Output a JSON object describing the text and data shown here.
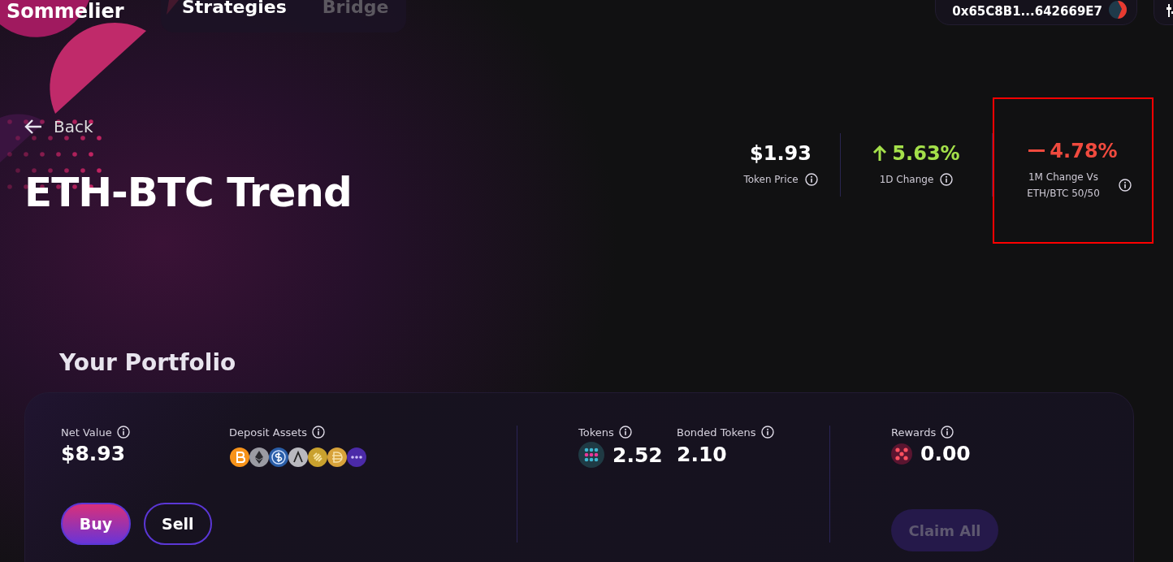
{
  "header": {
    "logo": "Sommelier",
    "nav": [
      {
        "label": "Strategies",
        "selected": true
      },
      {
        "label": "Bridge",
        "selected": false
      }
    ],
    "wallet": {
      "address": "0x65C8B1...642669E7"
    }
  },
  "back": {
    "label": "Back"
  },
  "title": "ETH-BTC Trend",
  "stats": [
    {
      "value": "$1.93",
      "label": "Token Price",
      "kind": "neutral",
      "highlighted": false
    },
    {
      "value": "5.63%",
      "label": "1D Change",
      "kind": "up",
      "highlighted": false
    },
    {
      "value": "4.78%",
      "label": "1M Change Vs ETH/BTC 50/50",
      "kind": "down",
      "highlighted": true
    }
  ],
  "portfolio": {
    "heading": "Your Portfolio",
    "net_value": {
      "label": "Net Value",
      "value": "$8.93"
    },
    "deposit_assets": {
      "label": "Deposit Assets",
      "coins": [
        {
          "kind": "btc"
        },
        {
          "kind": "eth"
        },
        {
          "kind": "usdc"
        },
        {
          "kind": "lambda"
        },
        {
          "kind": "busd"
        },
        {
          "kind": "dai"
        },
        {
          "kind": "more"
        }
      ]
    },
    "buttons": [
      {
        "label": "Buy",
        "kind": "primary"
      },
      {
        "label": "Sell",
        "kind": "outline"
      }
    ],
    "tokens": {
      "label": "Tokens",
      "value": "2.52"
    },
    "bonded_tokens": {
      "label": "Bonded Tokens",
      "value": "2.10"
    },
    "rewards": {
      "label": "Rewards",
      "value": "0.00"
    },
    "claim_button": {
      "label": "Claim All",
      "disabled": true
    }
  }
}
